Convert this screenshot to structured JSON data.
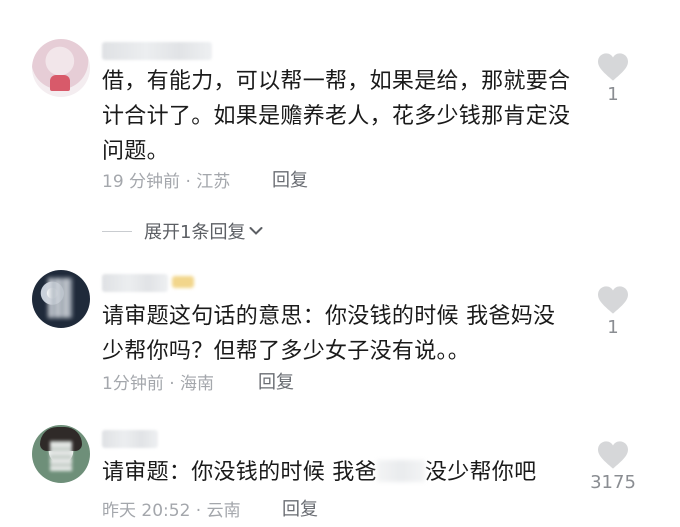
{
  "comments": [
    {
      "text": "借，有能力，可以帮一帮，如果是给，那就要合计合计了。如果是赡养老人，花多少钱那肯定没问题。",
      "meta": "19 分钟前 · 江苏",
      "reply_label": "回复",
      "likes": "1"
    },
    {
      "text": "请审题这句话的意思：你没钱的时候 我爸妈没少帮你吗？但帮了多少女子没有说。。",
      "meta": "1分钟前 · 海南",
      "reply_label": "回复",
      "likes": "1"
    },
    {
      "text_before": "请审题：你没钱的时候 我爸",
      "text_after": "没少帮你吧",
      "meta": "昨天 20:52 · 云南",
      "reply_label": "回复",
      "likes": "3175"
    }
  ],
  "expand_replies": "展开1条回复",
  "icons": {
    "like": "heart-icon",
    "expand": "chevron-down-icon"
  },
  "colors": {
    "text": "#1a1a1a",
    "meta": "#a4a7ac",
    "heart": "#d6d7d9"
  }
}
